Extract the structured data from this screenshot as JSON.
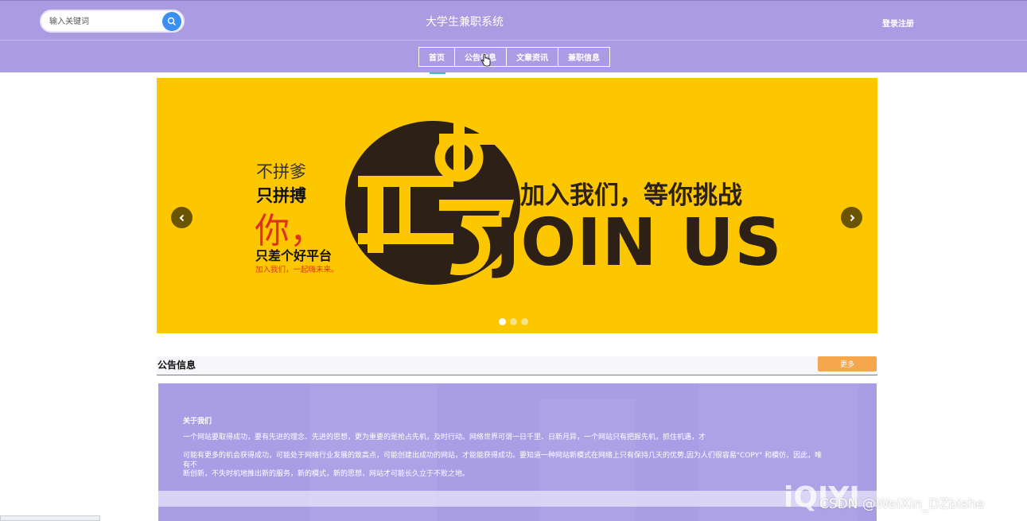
{
  "header": {
    "search_placeholder": "输入关键词",
    "title": "大学生兼职系统",
    "login_label": "登录注册"
  },
  "nav": {
    "items": [
      "首页",
      "公告信息",
      "文章资讯",
      "兼职信息"
    ]
  },
  "banner": {
    "left_line1": "不拼爹",
    "left_line2": "只拼搏",
    "left_line3": "你，",
    "left_line4": "只差个好平台",
    "left_line5": "加入我们，一起嗨未来。",
    "logo_char": "聘",
    "slogan": "加入我们，等你挑战",
    "join_text": "JOIN US",
    "slide_count": 3,
    "active_slide": 1
  },
  "notice_section": {
    "title": "公告信息",
    "more_label": "更多"
  },
  "about": {
    "title": "关于我们",
    "line1": "一个网站要取得成功，要有先进的理念、先进的思想，更为重要的是抢占先机，及时行动。网络世界可谓一日千里、日新月异，一个网站只有把握先机，抓住机遇，才",
    "line2": "可能有更多的机会获得成功，可能处于网络行业发展的致高点，可能创建出成功的网站，才能能获得成功。要知道一种网站新模式在网络上只有保持几天的优势,因为人们很容易\"COPY\" 和模仿，因此，唯有不",
    "line3": "断创新，不失时机地推出新的服务，新的模式，新的思想，网站才可能长久立于不败之地。"
  },
  "watermark": {
    "brand": "iQIYI",
    "credit": "CSDN @WeiXin_DZbishe"
  },
  "colors": {
    "header_bg": "#aa9be3",
    "banner_bg": "#fdc700",
    "more_button": "#f6a64c",
    "search_button": "#3b8ff0"
  }
}
